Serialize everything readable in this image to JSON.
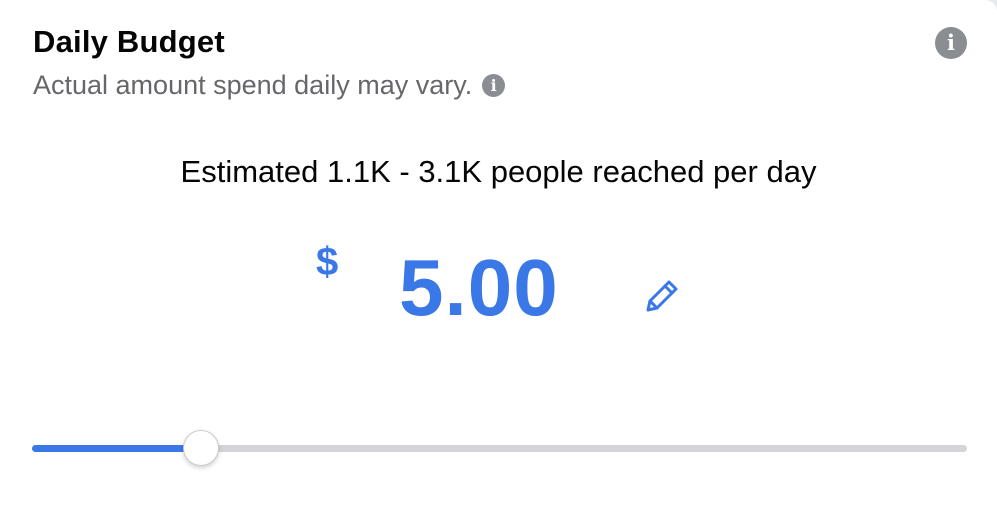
{
  "header": {
    "title": "Daily Budget",
    "subtitle": "Actual amount spend daily may vary.",
    "info_icon_glyph": "i",
    "info_icon": "info-circle-icon"
  },
  "estimate": {
    "text": "Estimated 1.1K - 3.1K people reached per day"
  },
  "budget": {
    "currency_symbol": "$",
    "amount": "5.00",
    "edit_icon": "pencil-icon"
  },
  "slider": {
    "fraction": 0.181
  },
  "colors": {
    "accent": "#3b78e7",
    "track": "#d4d5d8",
    "title": "#050505",
    "subtitle": "#65676b",
    "info_icon": "#8a8d91"
  }
}
